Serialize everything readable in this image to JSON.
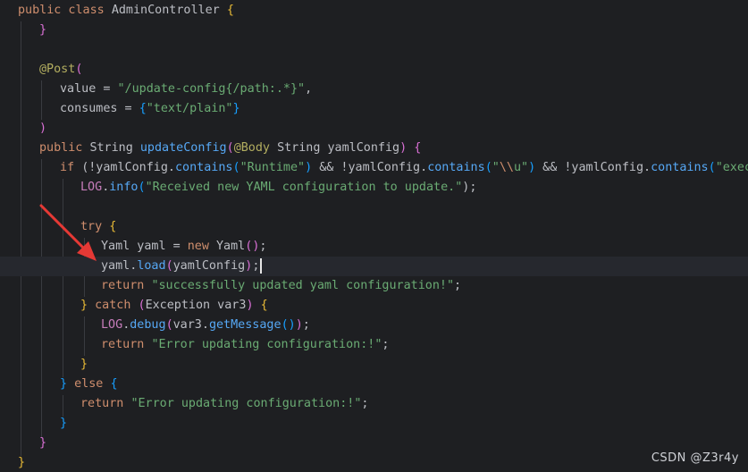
{
  "code": {
    "l01": [
      "public class",
      "AdminController",
      "{"
    ],
    "l02": "}",
    "l04_ann": "@Post",
    "l04_p": "(",
    "l05": [
      "value = ",
      "\"/update-config{/path:.*}\"",
      ","
    ],
    "l06": [
      "consumes = ",
      "{",
      "\"text/plain\"",
      "}"
    ],
    "l07": ")",
    "l08": [
      "public",
      "String",
      "updateConfig",
      "(",
      "@Body",
      "String yamlConfig",
      ")",
      "{"
    ],
    "l09": [
      "if",
      "(!yamlConfig.",
      "contains",
      "(",
      "\"Runtime\"",
      ")",
      " && !yamlConfig.",
      "contains",
      "(",
      "\"",
      "\\\\",
      "u\"",
      ")",
      " && !yamlConfig.",
      "contains",
      "(",
      "\"exec\"",
      ")"
    ],
    "l10": [
      "LOG",
      ".",
      "info",
      "(",
      "\"Received new YAML configuration to update.\"",
      ");"
    ],
    "l12": [
      "try",
      "{"
    ],
    "l13": [
      "Yaml yaml = ",
      "new",
      "Yaml",
      "(",
      ")",
      ";"
    ],
    "l14": [
      "yaml.",
      "load",
      "(",
      "yamlConfig",
      ")",
      ";"
    ],
    "l15": [
      "return",
      "\"successfully updated yaml configuration!\"",
      ";"
    ],
    "l16": [
      "}",
      "catch",
      "(",
      "Exception var3",
      ")",
      "{"
    ],
    "l17": [
      "LOG",
      ".",
      "debug",
      "(",
      "var3.",
      "getMessage",
      "()",
      ")",
      ";"
    ],
    "l18": [
      "return",
      "\"Error updating configuration:!\"",
      ";"
    ],
    "l19": "}",
    "l20": [
      "}",
      "else",
      "{"
    ],
    "l21": [
      "return",
      "\"Error updating configuration:!\"",
      ";"
    ],
    "l22": "}",
    "l23": "}",
    "l24": "}"
  },
  "watermark": "CSDN @Z3r4y",
  "annotation": {
    "arrow_color": "#e53935",
    "icon": "red-arrow-icon"
  }
}
